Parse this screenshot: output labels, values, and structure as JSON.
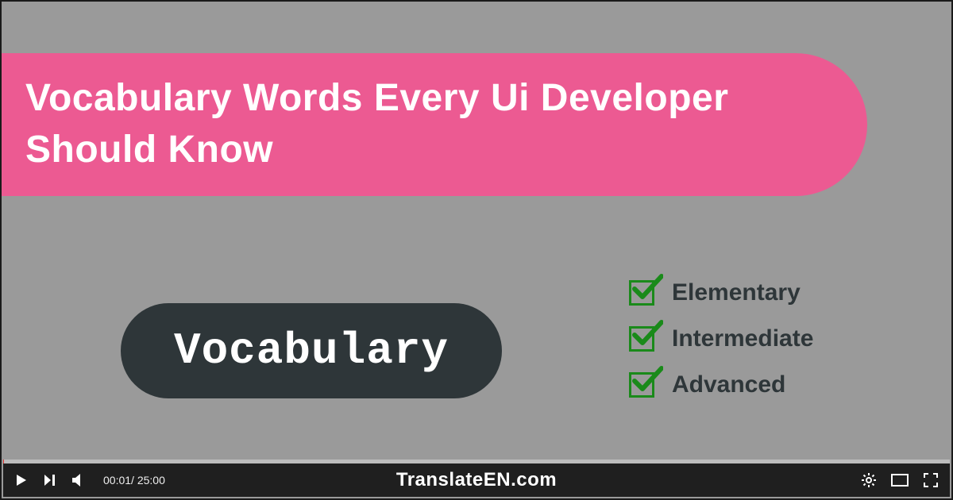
{
  "title": "Vocabulary Words Every Ui Developer Should Know",
  "pill_label": "Vocabulary",
  "levels": [
    {
      "label": "Elementary"
    },
    {
      "label": "Intermediate"
    },
    {
      "label": "Advanced"
    }
  ],
  "player": {
    "current_time": "00:01",
    "duration": "25:00",
    "watermark": "TranslateEN.com"
  }
}
